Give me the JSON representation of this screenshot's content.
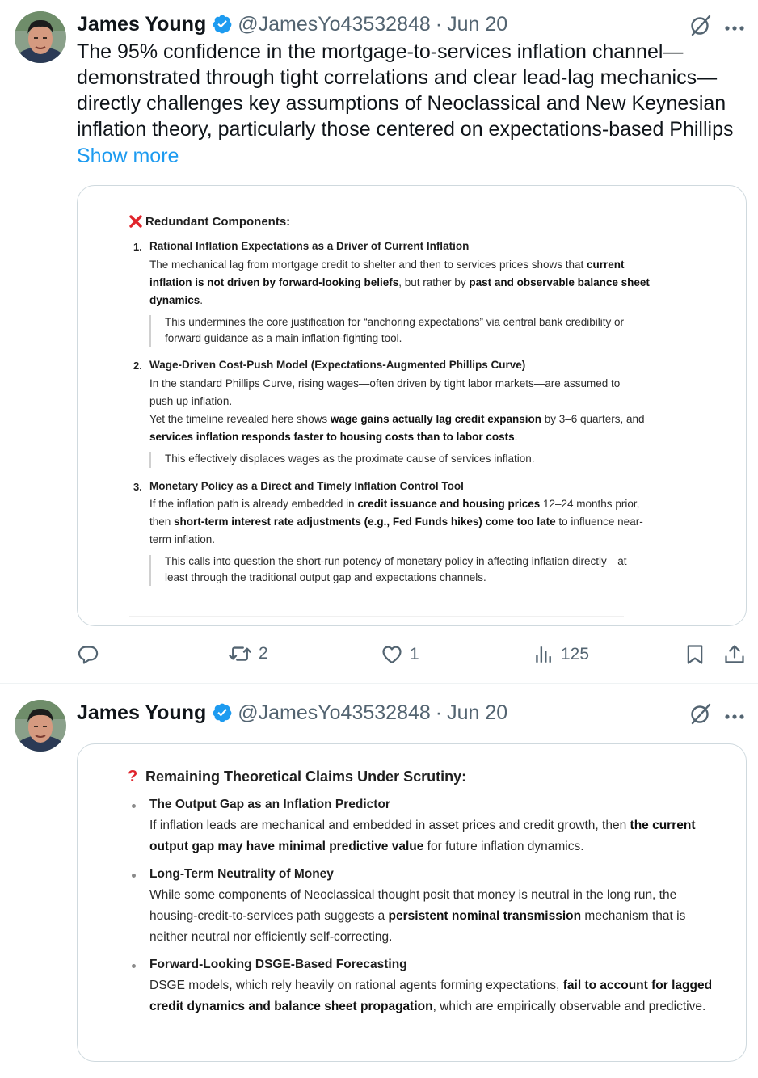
{
  "tweet1": {
    "name": "James Young",
    "handle": "@JamesYo43532848",
    "sep": "·",
    "date": "Jun 20",
    "text_lines": [
      "The 95% confidence in the mortgage-to-services inflation channel—",
      "demonstrated through tight correlations and clear lead-lag mechanics—",
      "directly challenges key assumptions of Neoclassical and New Keynesian",
      "inflation theory, particularly those centered on expectations-based Phillips"
    ],
    "show_more": "Show more",
    "card": {
      "icon": "red-x-icon",
      "title": "Redundant Components:",
      "items": [
        {
          "num": "1.",
          "heading": "Rational Inflation Expectations as a Driver of Current Inflation",
          "lines": [
            [
              "The mechanical lag from mortgage credit to shelter and then to services prices shows that ",
              "current"
            ],
            [
              "inflation is not driven by forward-looking beliefs",
              ", but rather by ",
              "past and observable balance sheet"
            ],
            [
              "dynamics",
              "."
            ]
          ],
          "quote": [
            "This undermines the core justification for “anchoring expectations” via central bank credibility or",
            "forward guidance as a main inflation-fighting tool."
          ]
        },
        {
          "num": "2.",
          "heading": "Wage-Driven Cost-Push Model (Expectations-Augmented Phillips Curve)",
          "lines": [
            [
              "In the standard Phillips Curve, rising wages—often driven by tight labor markets—are assumed to"
            ],
            [
              "push up inflation."
            ],
            [
              "Yet the timeline revealed here shows ",
              "wage gains actually lag credit expansion",
              " by 3–6 quarters, and"
            ],
            [
              "services inflation responds faster to housing costs than to labor costs",
              "."
            ]
          ],
          "quote": [
            "This effectively displaces wages as the proximate cause of services inflation."
          ]
        },
        {
          "num": "3.",
          "heading": "Monetary Policy as a Direct and Timely Inflation Control Tool",
          "lines": [
            [
              "If the inflation path is already embedded in ",
              "credit issuance and housing prices",
              " 12–24 months prior,"
            ],
            [
              "then ",
              "short-term interest rate adjustments (e.g., Fed Funds hikes) come too late",
              " to influence near-"
            ],
            [
              "term inflation."
            ]
          ],
          "quote": [
            "This calls into question the short-run potency of monetary policy in affecting inflation directly—at",
            "least through the traditional output gap and expectations channels."
          ]
        }
      ]
    },
    "actions": {
      "reply_count": "",
      "retweet_count": "2",
      "like_count": "1",
      "views_count": "125"
    }
  },
  "tweet2": {
    "name": "James Young",
    "handle": "@JamesYo43532848",
    "sep": "·",
    "date": "Jun 20",
    "card": {
      "icon": "red-question-icon",
      "title": "Remaining Theoretical Claims Under Scrutiny:",
      "items": [
        {
          "heading": "The Output Gap as an Inflation Predictor",
          "lines": [
            [
              "If inflation leads are mechanical and embedded in asset prices and credit growth, then ",
              "the current"
            ],
            [
              "output gap may have minimal predictive value",
              " for future inflation dynamics."
            ]
          ]
        },
        {
          "heading": "Long-Term Neutrality of Money",
          "lines": [
            [
              "While some components of Neoclassical thought posit that money is neutral in the long run, the"
            ],
            [
              "housing-credit-to-services path suggests a ",
              "persistent nominal transmission",
              " mechanism that is"
            ],
            [
              "neither neutral nor efficiently self-correcting."
            ]
          ]
        },
        {
          "heading": "Forward-Looking DSGE-Based Forecasting",
          "lines": [
            [
              "DSGE models, which rely heavily on rational agents forming expectations, ",
              "fail to account for lagged"
            ],
            [
              "credit dynamics and balance sheet propagation",
              ", which are empirically observable and predictive."
            ]
          ]
        }
      ]
    }
  },
  "colors": {
    "accent": "#1d9bf0",
    "muted": "#536471",
    "red": "#e0242b"
  }
}
